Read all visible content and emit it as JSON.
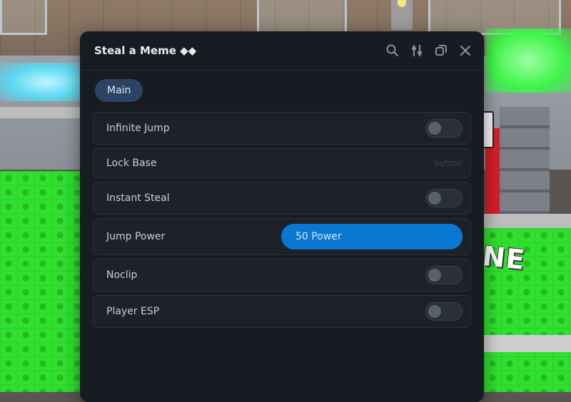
{
  "window": {
    "title": "Steal a Meme ◆◆",
    "icons": [
      "search-icon",
      "sliders-icon",
      "restore-icon",
      "close-icon"
    ]
  },
  "tabs": [
    {
      "label": "Main",
      "active": true
    }
  ],
  "items": [
    {
      "type": "toggle",
      "label": "Infinite Jump",
      "on": false
    },
    {
      "type": "button",
      "label": "Lock Base",
      "hint": "button"
    },
    {
      "type": "toggle",
      "label": "Instant Steal",
      "on": false
    },
    {
      "type": "slider",
      "label": "Jump Power",
      "value_text": "50 Power"
    },
    {
      "type": "toggle",
      "label": "Noclip",
      "on": false
    },
    {
      "type": "toggle",
      "label": "Player ESP",
      "on": false
    }
  ],
  "background": {
    "sign_text": "NE"
  },
  "colors": {
    "window_bg": "#171b22",
    "row_bg": "#1d222a",
    "accent": "#0a78d2",
    "tab_bg": "#2b4466"
  }
}
